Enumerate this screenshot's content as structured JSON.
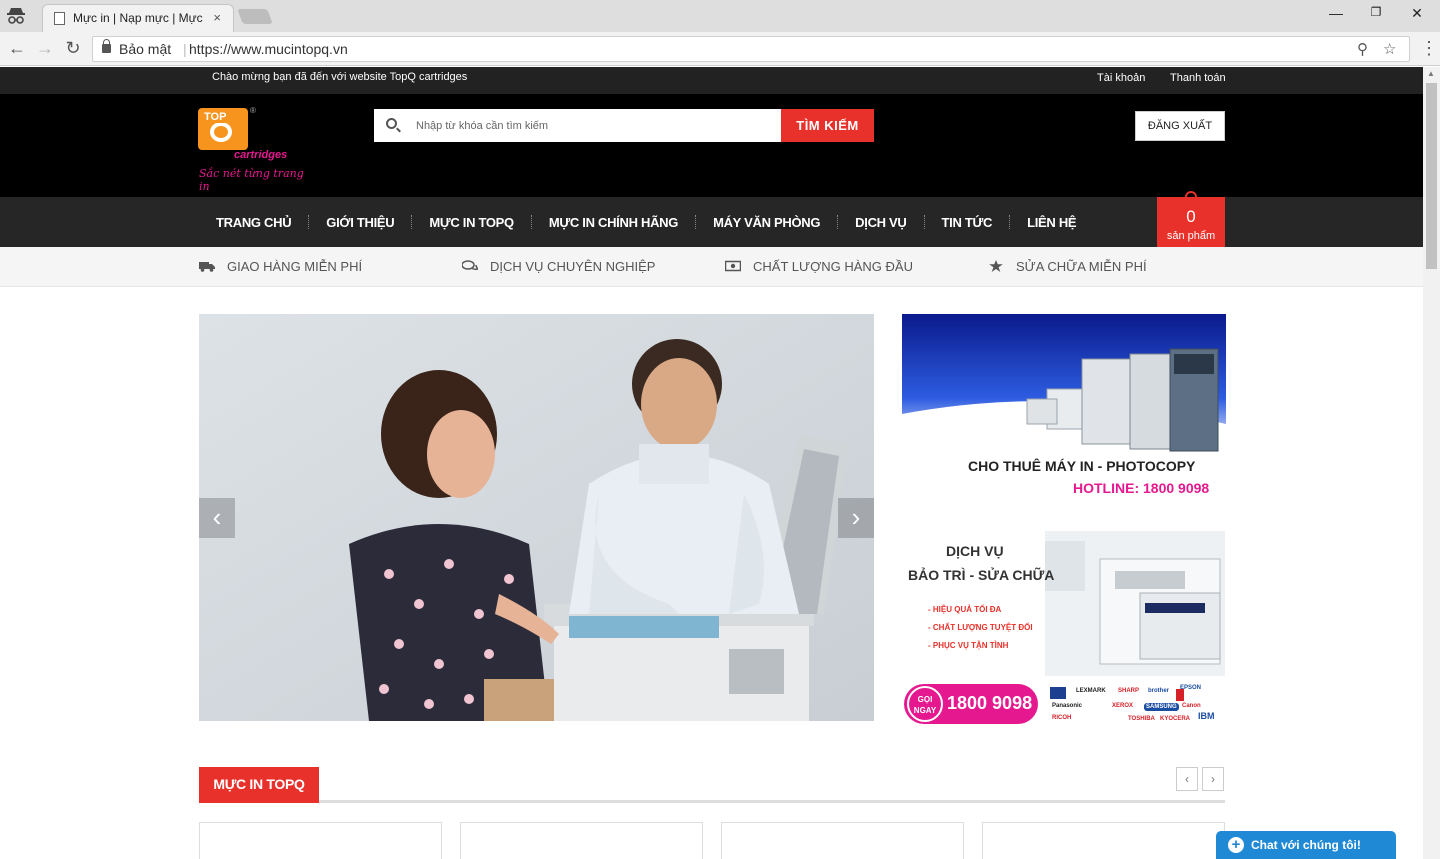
{
  "browser": {
    "tab_title": "Mực in | Nạp mực | Mực",
    "tab_close": "×",
    "window_controls": [
      "—",
      "❐",
      "✕"
    ],
    "back": "←",
    "forward": "→",
    "reload": "↻",
    "secure_label": "Bảo mật",
    "separator": "|",
    "url": "https://www.mucintopq.vn",
    "zoom_icon": "⚲",
    "star_icon": "☆",
    "menu_icon": "⋮"
  },
  "topbar": {
    "welcome": "Chào mừng bạn đã đến với website TopQ cartridges",
    "account": "Tài khoản",
    "checkout": "Thanh toán"
  },
  "header": {
    "logo_top": "TOP",
    "logo_brand": "cartridges",
    "logo_slogan": "Sắc nét từng trang in",
    "logo_reg": "®",
    "search_placeholder": "Nhập từ khóa cần tìm kiếm",
    "search_button": "TÌM KIẾM",
    "logout_button": "ĐĂNG XUẤT"
  },
  "nav": {
    "items": [
      "TRANG CHỦ",
      "GIỚI THIỆU",
      "MỰC IN TOPQ",
      "MỰC IN CHÍNH HÃNG",
      "MÁY VĂN PHÒNG",
      "DỊCH VỤ",
      "TIN TỨC",
      "LIÊN HỆ"
    ],
    "cart_count": "0",
    "cart_label": "sản phẩm"
  },
  "features": [
    {
      "label": "GIAO HÀNG MIỄN PHÍ",
      "icon": "truck-icon"
    },
    {
      "label": "DỊCH VỤ CHUYÊN NGHIỆP",
      "icon": "chat-bubbles-icon"
    },
    {
      "label": "CHẤT LƯỢNG HÀNG ĐẦU",
      "icon": "banknote-icon"
    },
    {
      "label": "SỬA CHỮA MIỄN PHÍ",
      "icon": "star-icon"
    }
  ],
  "slider": {
    "prev": "‹",
    "next": "›"
  },
  "banner1": {
    "title": "CHO THUÊ MÁY IN - PHOTOCOPY",
    "hotline": "HOTLINE: 1800 9098"
  },
  "banner2": {
    "title1": "DỊCH VỤ",
    "title2": "BẢO TRÌ - SỬA CHỮA",
    "bullets": [
      "- HIỆU QUẢ TỐI ĐA",
      "- CHẤT LƯỢNG TUYỆT ĐỐI",
      "- PHỤC VỤ TẬN TÌNH"
    ],
    "call_label_1": "GỌI",
    "call_label_2": "NGAY",
    "call_number": "1800 9098",
    "brands": [
      "LEXMARK",
      "SHARP",
      "brother",
      "EPSON",
      "Panasonic",
      "XEROX",
      "SAMSUNG",
      "Canon",
      "RICOH",
      "TOSHIBA",
      "KYOCERA",
      "IBM"
    ]
  },
  "section": {
    "title": "MỰC IN TOPQ",
    "prev": "‹",
    "next": "›"
  },
  "chat": {
    "icon": "+",
    "label": "Chat với chúng tôi!"
  },
  "colors": {
    "accent_red": "#e8312a",
    "brand_pink": "#e5188f",
    "brand_orange": "#f7941d",
    "chat_blue": "#2089d6"
  }
}
